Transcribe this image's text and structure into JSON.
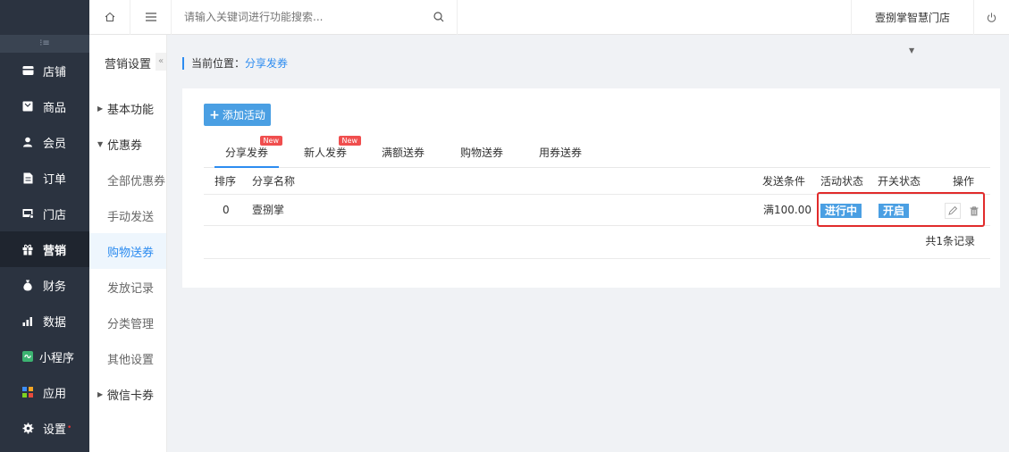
{
  "nav": {
    "collapse_glyph": "⁝≡",
    "items": [
      {
        "label": "店铺",
        "icon": "store-icon"
      },
      {
        "label": "商品",
        "icon": "goods-icon"
      },
      {
        "label": "会员",
        "icon": "member-icon"
      },
      {
        "label": "订单",
        "icon": "order-icon"
      },
      {
        "label": "门店",
        "icon": "shop-icon"
      },
      {
        "label": "营销",
        "icon": "gift-icon"
      },
      {
        "label": "财务",
        "icon": "money-bag-icon"
      },
      {
        "label": "数据",
        "icon": "bar-chart-icon"
      },
      {
        "label": "小程序",
        "icon": "mini-program-icon"
      },
      {
        "label": "应用",
        "icon": "apps-icon"
      },
      {
        "label": "设置",
        "icon": "gear-icon"
      }
    ],
    "settings_dot": "•"
  },
  "topbar": {
    "search_placeholder": "请输入关键词进行功能搜索...",
    "store_name": "壹捌掌智慧门店"
  },
  "sub": {
    "title": "营销设置",
    "collapse_glyph": "«",
    "group_basic": "基本功能",
    "group_coupon": "优惠券",
    "items": [
      "全部优惠券",
      "手动发送",
      "购物送券",
      "发放记录",
      "分类管理",
      "其他设置"
    ],
    "group_wechat": "微信卡券"
  },
  "breadcrumb": {
    "prefix": "当前位置：",
    "current": "分享发券"
  },
  "main": {
    "add_button": "添加活动",
    "add_plus": "+",
    "tabs": [
      {
        "label": "分享发券",
        "badge": "New"
      },
      {
        "label": "新人发券",
        "badge": "New"
      },
      {
        "label": "满额送券",
        "badge": ""
      },
      {
        "label": "购物送券",
        "badge": ""
      },
      {
        "label": "用券送券",
        "badge": ""
      }
    ],
    "columns": {
      "sort": "排序",
      "name": "分享名称",
      "condition": "发送条件",
      "activity_status": "活动状态",
      "switch_status": "开关状态",
      "actions": "操作"
    },
    "rows": [
      {
        "sort": "0",
        "name": "壹捌掌",
        "condition": "满100.00",
        "activity_status": "进行中",
        "switch_status": "开启"
      }
    ],
    "total": "共1条记录"
  },
  "colors": {
    "accent": "#2d8cf0",
    "tag_blue": "#4a9fe3",
    "nav_bg": "#2b3340",
    "highlight_red": "#e12b2b",
    "badge_red": "#f04e4e"
  }
}
